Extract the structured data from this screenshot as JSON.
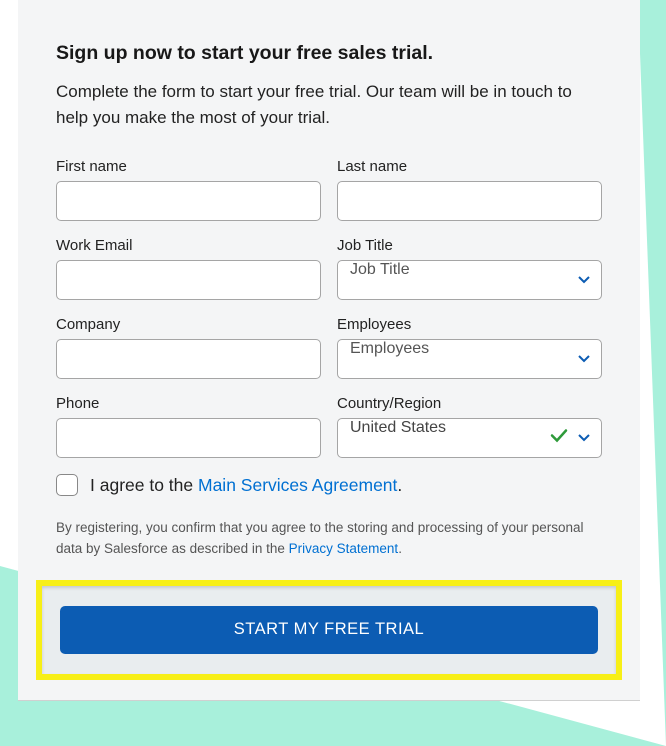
{
  "heading": "Sign up now to start your free sales trial.",
  "subheading": "Complete the form to start your free trial. Our team will be in touch to help you make the most of your trial.",
  "form": {
    "first_name": {
      "label": "First name",
      "value": ""
    },
    "last_name": {
      "label": "Last name",
      "value": ""
    },
    "work_email": {
      "label": "Work Email",
      "value": ""
    },
    "job_title": {
      "label": "Job Title",
      "placeholder": "Job Title"
    },
    "company": {
      "label": "Company",
      "value": ""
    },
    "employees": {
      "label": "Employees",
      "placeholder": "Employees"
    },
    "phone": {
      "label": "Phone",
      "value": ""
    },
    "country": {
      "label": "Country/Region",
      "value": "United States"
    }
  },
  "agree": {
    "prefix": "I agree to the ",
    "link_text": "Main Services Agreement",
    "suffix": "."
  },
  "disclaimer": {
    "prefix": "By registering, you confirm that you agree to the storing and processing of your personal data by Salesforce as described in the ",
    "link_text": "Privacy Statement",
    "suffix": "."
  },
  "cta_label": "START MY FREE TRIAL",
  "colors": {
    "accent": "#0c5cb3",
    "highlight": "#f7ef17",
    "link": "#0070d2",
    "check": "#2e9a3a"
  }
}
